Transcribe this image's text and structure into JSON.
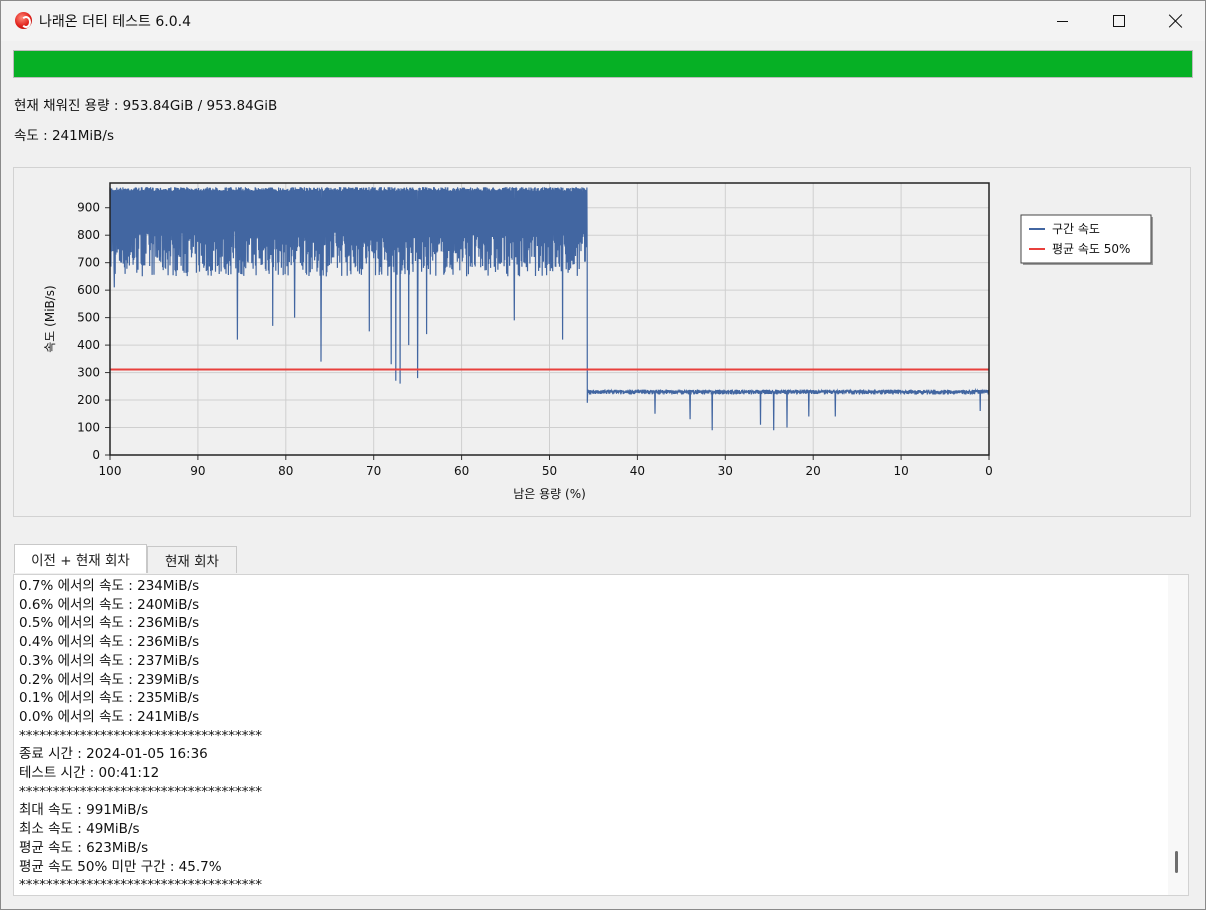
{
  "window": {
    "title": "나래온 더티 테스트 6.0.4",
    "controls": {
      "minimize": "minimize",
      "maximize": "maximize",
      "close": "close"
    }
  },
  "progress": {
    "percent": 100,
    "color": "#06b025"
  },
  "status": {
    "fill_text": "현재 채워진 용량 : 953.84GiB / 953.84GiB",
    "speed_text": "속도 : 241MiB/s"
  },
  "chart_data": {
    "type": "line",
    "xlabel": "남은 용량 (%)",
    "ylabel": "속도 (MiB/s)",
    "xlim": [
      100,
      0
    ],
    "ylim": [
      0,
      990
    ],
    "x_ticks": [
      100,
      90,
      80,
      70,
      60,
      50,
      40,
      30,
      20,
      10,
      0
    ],
    "y_ticks": [
      0,
      100,
      200,
      300,
      400,
      500,
      600,
      700,
      800,
      900
    ],
    "grid": true,
    "legend_position": "right",
    "series": [
      {
        "name": "구간 속도",
        "color": "#4266a1",
        "segments": [
          {
            "x_from": 100,
            "x_to": 45.7,
            "y_high": 975,
            "y_typical_low": 650
          },
          {
            "x_from": 45.7,
            "x_to": 0,
            "y_high": 238,
            "y_typical_low": 220
          }
        ],
        "notable_dips": [
          {
            "x": 99.5,
            "y": 610
          },
          {
            "x": 85.5,
            "y": 420
          },
          {
            "x": 81.5,
            "y": 470
          },
          {
            "x": 79,
            "y": 500
          },
          {
            "x": 76,
            "y": 340
          },
          {
            "x": 70.5,
            "y": 450
          },
          {
            "x": 68,
            "y": 330
          },
          {
            "x": 67.5,
            "y": 270
          },
          {
            "x": 67,
            "y": 260
          },
          {
            "x": 66,
            "y": 400
          },
          {
            "x": 65,
            "y": 280
          },
          {
            "x": 64,
            "y": 440
          },
          {
            "x": 54,
            "y": 490
          },
          {
            "x": 48.5,
            "y": 420
          },
          {
            "x": 45.7,
            "y": 190
          },
          {
            "x": 38,
            "y": 150
          },
          {
            "x": 34,
            "y": 130
          },
          {
            "x": 31.5,
            "y": 90
          },
          {
            "x": 26,
            "y": 110
          },
          {
            "x": 24.5,
            "y": 90
          },
          {
            "x": 23,
            "y": 100
          },
          {
            "x": 20.5,
            "y": 140
          },
          {
            "x": 17.5,
            "y": 140
          },
          {
            "x": 1,
            "y": 160
          }
        ]
      },
      {
        "name": "평균 속도 50%",
        "color": "#e8403c",
        "values": [
          {
            "x": 100,
            "y": 311
          },
          {
            "x": 0,
            "y": 311
          }
        ]
      }
    ]
  },
  "tabs": [
    {
      "label": "이전 + 현재 회차",
      "active": true
    },
    {
      "label": "현재 회차",
      "active": false
    }
  ],
  "log": [
    "0.7% 에서의 속도 : 234MiB/s",
    "0.6% 에서의 속도 : 240MiB/s",
    "0.5% 에서의 속도 : 236MiB/s",
    "0.4% 에서의 속도 : 236MiB/s",
    "0.3% 에서의 속도 : 237MiB/s",
    "0.2% 에서의 속도 : 239MiB/s",
    "0.1% 에서의 속도 : 235MiB/s",
    "0.0% 에서의 속도 : 241MiB/s",
    "************************************",
    "종료 시간 : 2024-01-05 16:36",
    "테스트 시간 : 00:41:12",
    "************************************",
    "최대 속도 : 991MiB/s",
    "최소 속도 : 49MiB/s",
    "평균 속도 : 623MiB/s",
    "평균 속도 50% 미만 구간 : 45.7%",
    "************************************"
  ]
}
